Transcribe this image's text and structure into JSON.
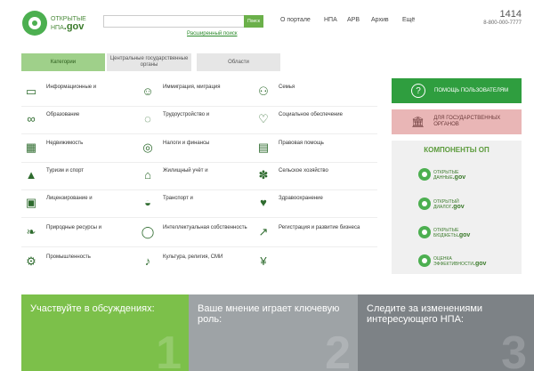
{
  "header": {
    "logo_top": "ОТКРЫТЫЕ",
    "logo_bottom": "НПА",
    "logo_gov": ".gov",
    "search_button": "Поиск",
    "advanced_search": "Расширенный поиск",
    "nav": [
      "О портале",
      "НПА",
      "АРВ",
      "Архив",
      "Ещё"
    ],
    "contact_num": "1414",
    "contact_phone": "8-800-000-7777"
  },
  "tabs": [
    {
      "label": "Категории",
      "active": true
    },
    {
      "label": "Центральные государственные органы",
      "active": false
    },
    {
      "label": "Области",
      "active": false
    }
  ],
  "categories": [
    [
      "Информационные и ",
      "Иммиграция, миграция",
      "Семья"
    ],
    [
      "Образование",
      "Трудоустройство и ",
      "Социальное обеспечение"
    ],
    [
      "Недвижимость",
      "Налоги и финансы",
      "Правовая помощь"
    ],
    [
      "Туризм и спорт",
      "Жилищный учёт и ",
      "Сельское хозяйство"
    ],
    [
      "Лицензирование и ",
      "Транспорт и ",
      "Здравоохранение"
    ],
    [
      "Природные ресурсы и ",
      "Интеллектуальная собственность",
      "Регистрация и развитие бизнеса"
    ],
    [
      "Промышленность",
      "Культура, религия, СМИ",
      ""
    ]
  ],
  "category_icons": [
    [
      "monitor-icon",
      "person-icon",
      "family-icon"
    ],
    [
      "glasses-icon",
      "chat-icon",
      "hand-heart-icon"
    ],
    [
      "building-icon",
      "coins-icon",
      "law-book-icon"
    ],
    [
      "mountain-icon",
      "cap-icon",
      "wheat-icon"
    ],
    [
      "license-icon",
      "car-icon",
      "heart-pulse-icon"
    ],
    [
      "leaf-icon",
      "lightbulb-icon",
      "growth-chart-icon"
    ],
    [
      "gear-icon",
      "microphone-icon",
      "economy-icon"
    ]
  ],
  "sidebar": {
    "help_label": "ПОМОЩЬ ПОЛЬЗОВАТЕЛЯМ",
    "gov_label": "ДЛЯ ГОСУДАРСТВЕННЫХ ОРГАНОВ",
    "components_title": "КОМПОНЕНТЫ ОП",
    "components": [
      {
        "top": "ОТКРЫТЫЕ",
        "bottom": "ДАННЫЕ",
        "gov": ".gov"
      },
      {
        "top": "ОТКРЫТЫЙ",
        "bottom": "ДИАЛОГ",
        "gov": ".gov"
      },
      {
        "top": "ОТКРЫТЫЕ",
        "bottom": "БЮДЖЕТЫ",
        "gov": ".gov"
      },
      {
        "top": "ОЦЕНКА",
        "bottom": "ЭФФЕКТИВНОСТИ",
        "gov": ".gov"
      }
    ]
  },
  "banners": [
    {
      "title": "Участвуйте в обсуждениях:",
      "num": "1",
      "color": "#7cc04a"
    },
    {
      "title": "Ваше мнение играет ключевую роль:",
      "num": "2",
      "color": "#9ea3a6"
    },
    {
      "title": "Следите за изменениями интересующего НПА:",
      "num": "3",
      "color": "#7d8286"
    }
  ],
  "colors": {
    "accent": "#4caf50",
    "help_green": "#2f9e3f",
    "gov_pink": "#e9b6b6"
  }
}
